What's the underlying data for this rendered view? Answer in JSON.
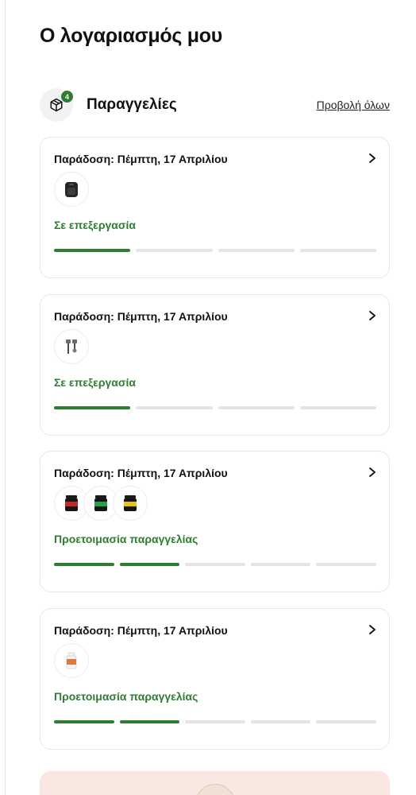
{
  "page": {
    "title": "Ο λογαριασμός μου"
  },
  "orders_section": {
    "title": "Παραγγελίες",
    "count": "4",
    "view_all_label": "Προβολή όλων",
    "icon": "package-icon"
  },
  "colors": {
    "accent": "#2e7d32",
    "track": "#e4e4e4",
    "promo_bg": "#f9e7e1"
  },
  "orders": [
    {
      "delivery": "Παράδοση: Πέμπτη, 17 Απριλίου",
      "status": "Σε επεξεργασία",
      "steps_completed": 1,
      "steps_total": 4,
      "products": [
        "air-fryer-icon"
      ]
    },
    {
      "delivery": "Παράδοση: Πέμπτη, 17 Απριλίου",
      "status": "Σε επεξεργασία",
      "steps_completed": 1,
      "steps_total": 4,
      "products": [
        "garden-tools-icon"
      ]
    },
    {
      "delivery": "Παράδοση: Πέμπτη, 17 Απριλίου",
      "status": "Προετοιμασία παραγγελίας",
      "steps_completed": 2,
      "steps_total": 5,
      "products": [
        "protein-tub-red-icon",
        "protein-tub-green-icon",
        "protein-tub-yellow-icon"
      ]
    },
    {
      "delivery": "Παράδοση: Πέμπτη, 17 Απριλίου",
      "status": "Προετοιμασία παραγγελίας",
      "steps_completed": 2,
      "steps_total": 5,
      "products": [
        "supplement-bottle-icon"
      ]
    }
  ]
}
